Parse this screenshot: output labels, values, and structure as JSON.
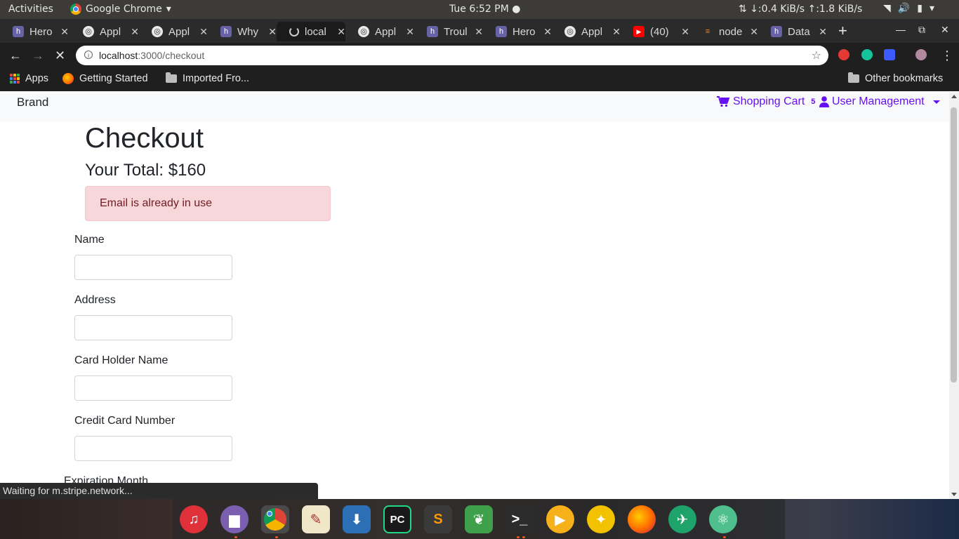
{
  "topbar": {
    "activities": "Activities",
    "app_name": "Google Chrome",
    "clock": "Tue  6:52 PM",
    "net_speed": "↓:0.4 KiB/s ↑:1.8 KiB/s"
  },
  "tabs": [
    {
      "title": "Hero",
      "icon": "heroku-icon",
      "color": "#6762a6"
    },
    {
      "title": "Appl",
      "icon": "globe-icon",
      "color": "#444"
    },
    {
      "title": "Appl",
      "icon": "globe-icon",
      "color": "#444"
    },
    {
      "title": "Why",
      "icon": "heroku-icon",
      "color": "#6762a6"
    },
    {
      "title": "local",
      "icon": "loading-icon",
      "color": "#444"
    },
    {
      "title": "Appl",
      "icon": "globe-icon",
      "color": "#444"
    },
    {
      "title": "Troul",
      "icon": "heroku-icon",
      "color": "#6762a6"
    },
    {
      "title": "Hero",
      "icon": "heroku-icon",
      "color": "#6762a6"
    },
    {
      "title": "Appl",
      "icon": "globe-icon",
      "color": "#444"
    },
    {
      "title": "(40)",
      "icon": "youtube-icon",
      "color": "#ff0000"
    },
    {
      "title": "node",
      "icon": "stackoverflow-icon",
      "color": "#f48024"
    },
    {
      "title": "Data",
      "icon": "heroku-icon",
      "color": "#6762a6"
    }
  ],
  "toolbar": {
    "url_host": "localhost",
    "url_path": ":3000/checkout"
  },
  "bookmarks": {
    "apps": "Apps",
    "getting_started": "Getting Started",
    "imported": "Imported Fro...",
    "other": "Other bookmarks"
  },
  "navbar": {
    "brand": "Brand",
    "cart_label": "Shopping Cart",
    "cart_count": "5",
    "user_menu": "User Management"
  },
  "checkout": {
    "title": "Checkout",
    "total": "Your Total: $160",
    "error": "Email is already in use",
    "fields": {
      "name": {
        "label": "Name",
        "value": ""
      },
      "address": {
        "label": "Address",
        "value": ""
      },
      "card_holder": {
        "label": "Card Holder Name",
        "value": ""
      },
      "card_number": {
        "label": "Credit Card Number",
        "value": ""
      }
    },
    "exp_month_label": "Expiration Month"
  },
  "status_text": "Waiting for m.stripe.network...",
  "colors": {
    "link": "#6610f2",
    "alert_bg": "#f8d7da",
    "alert_text": "#721c24"
  },
  "dock": [
    {
      "name": "rhythmbox-icon",
      "bg": "#e0303a",
      "glyph": "♫"
    },
    {
      "name": "files-icon",
      "bg": "#7a5fb0",
      "glyph": "▆"
    },
    {
      "name": "chrome-icon",
      "bg": "#555",
      "glyph": ""
    },
    {
      "name": "text-editor-icon",
      "bg": "#f0e6c8",
      "glyph": "✎"
    },
    {
      "name": "installer-icon",
      "bg": "#2d6fb5",
      "glyph": "⬇"
    },
    {
      "name": "pycharm-icon",
      "bg": "#1a1a1a",
      "glyph": "PC"
    },
    {
      "name": "sublime-icon",
      "bg": "#3a3a3a",
      "glyph": "S"
    },
    {
      "name": "leaf-icon",
      "bg": "#3ea04a",
      "glyph": "❦"
    },
    {
      "name": "terminal-icon",
      "bg": "#2c2c2c",
      "glyph": ">_"
    },
    {
      "name": "player-icon",
      "bg": "#f6b01a",
      "glyph": "▶"
    },
    {
      "name": "genie-icon",
      "bg": "#f2c200",
      "glyph": "✦"
    },
    {
      "name": "firefox-icon",
      "bg": "#e8622a",
      "glyph": ""
    },
    {
      "name": "robo3t-icon",
      "bg": "#1ea36a",
      "glyph": "✈"
    },
    {
      "name": "atom-icon",
      "bg": "#4fc08d",
      "glyph": "⚛"
    }
  ]
}
